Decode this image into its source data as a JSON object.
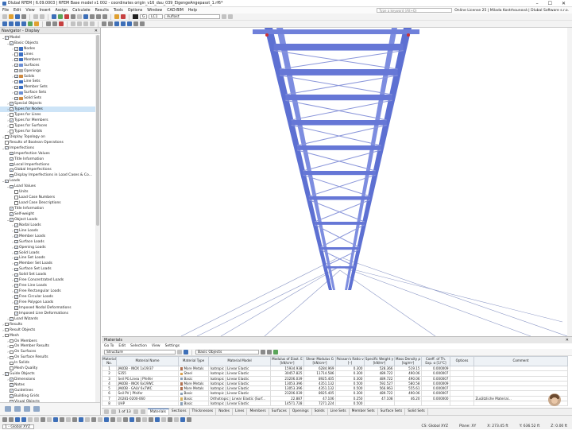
{
  "window": {
    "title": "Dlubal RFEM | 6.09.0003 | RFEM Base model v1 002 - coordinates origin_v16_dau_039_EigengeAngepasst_1.rf6*",
    "min": "–",
    "max": "☐",
    "close": "✕"
  },
  "menu": {
    "items": [
      "File",
      "Edit",
      "View",
      "Insert",
      "Assign",
      "Calculate",
      "Results",
      "Tools",
      "Options",
      "Window",
      "CAD-BIM",
      "Help"
    ],
    "search_placeholder": "Type a keyword (Alt+Q)",
    "license": "Online License 25 | Milada Kostrhounová | Dlubal Software s.r.o."
  },
  "toolbar": {
    "load_case_type": "G",
    "load_case": "LC1",
    "load_case_name": "Auflast"
  },
  "navigator": {
    "title": "Navigator - Display",
    "items": [
      {
        "level": 0,
        "exp": "⌄",
        "cb": "✓",
        "label": "Model"
      },
      {
        "level": 1,
        "exp": "⌄",
        "cb": "✓",
        "label": "Basic Objects"
      },
      {
        "level": 2,
        "exp": "›",
        "cb": "✓",
        "label": "Nodes",
        "icon": "#3b6fc4"
      },
      {
        "level": 2,
        "exp": "›",
        "cb": "",
        "label": "Lines",
        "icon": "#3b6fc4"
      },
      {
        "level": 2,
        "exp": "›",
        "cb": "✓",
        "label": "Members",
        "icon": "#3b6fc4"
      },
      {
        "level": 2,
        "exp": "›",
        "cb": "✓",
        "label": "Surfaces",
        "icon": "#6b8fd6"
      },
      {
        "level": 2,
        "exp": "",
        "cb": "✓",
        "label": "Openings",
        "icon": "#aaaaaa"
      },
      {
        "level": 2,
        "exp": "›",
        "cb": "✓",
        "label": "Solids",
        "icon": "#d08a40"
      },
      {
        "level": 2,
        "exp": "›",
        "cb": "✓",
        "label": "Line Sets",
        "icon": "#3b6fc4"
      },
      {
        "level": 2,
        "exp": "›",
        "cb": "✓",
        "label": "Member Sets",
        "icon": "#3b6fc4"
      },
      {
        "level": 2,
        "exp": "›",
        "cb": "✓",
        "label": "Surface Sets",
        "icon": "#6b8fd6"
      },
      {
        "level": 2,
        "exp": "›",
        "cb": "✓",
        "label": "Solid Sets",
        "icon": "#d08a40"
      },
      {
        "level": 1,
        "exp": "›",
        "cb": "✓",
        "label": "Special Objects"
      },
      {
        "level": 1,
        "exp": "›",
        "cb": "✓",
        "label": "Types for Nodes",
        "sel": true
      },
      {
        "level": 1,
        "exp": "›",
        "cb": "",
        "label": "Types for Lines"
      },
      {
        "level": 1,
        "exp": "›",
        "cb": "✓",
        "label": "Types for Members"
      },
      {
        "level": 1,
        "exp": "›",
        "cb": "",
        "label": "Types for Surfaces"
      },
      {
        "level": 1,
        "exp": "›",
        "cb": "",
        "label": "Types for Solids"
      },
      {
        "level": 0,
        "exp": "›",
        "cb": "",
        "label": "Display Topology on"
      },
      {
        "level": 0,
        "exp": "",
        "cb": "",
        "label": "Results of Boolean Operations"
      },
      {
        "level": 0,
        "exp": "⌄",
        "cb": "✓",
        "label": "Imperfections"
      },
      {
        "level": 1,
        "exp": "",
        "cb": "✓",
        "label": "Imperfection Values"
      },
      {
        "level": 1,
        "exp": "",
        "cb": "✓",
        "label": "Title Information"
      },
      {
        "level": 1,
        "exp": "",
        "cb": "✓",
        "label": "Local Imperfections"
      },
      {
        "level": 1,
        "exp": "",
        "cb": "✓",
        "label": "Global Imperfections"
      },
      {
        "level": 1,
        "exp": "",
        "cb": "✓",
        "label": "Display Imperfections in Load Cases & Co..."
      },
      {
        "level": 0,
        "exp": "⌄",
        "cb": "✓",
        "label": "Loads"
      },
      {
        "level": 1,
        "exp": "⌄",
        "cb": "✓",
        "label": "Load Values"
      },
      {
        "level": 2,
        "exp": "",
        "cb": "",
        "label": "Units"
      },
      {
        "level": 2,
        "exp": "",
        "cb": "",
        "label": "Load Case Numbers"
      },
      {
        "level": 2,
        "exp": "",
        "cb": "",
        "label": "Load Case Descriptions"
      },
      {
        "level": 1,
        "exp": "",
        "cb": "✓",
        "label": "Title Information"
      },
      {
        "level": 1,
        "exp": "",
        "cb": "✓",
        "label": "Self-weight"
      },
      {
        "level": 1,
        "exp": "⌄",
        "cb": "✓",
        "label": "Object Loads"
      },
      {
        "level": 2,
        "exp": "›",
        "cb": "✓",
        "label": "Nodal Loads"
      },
      {
        "level": 2,
        "exp": "›",
        "cb": "✓",
        "label": "Line Loads"
      },
      {
        "level": 2,
        "exp": "›",
        "cb": "✓",
        "label": "Member Loads"
      },
      {
        "level": 2,
        "exp": "›",
        "cb": "✓",
        "label": "Surface Loads"
      },
      {
        "level": 2,
        "exp": "›",
        "cb": "✓",
        "label": "Opening Loads"
      },
      {
        "level": 2,
        "exp": "›",
        "cb": "✓",
        "label": "Solid Loads"
      },
      {
        "level": 2,
        "exp": "›",
        "cb": "✓",
        "label": "Line Set Loads"
      },
      {
        "level": 2,
        "exp": "›",
        "cb": "✓",
        "label": "Member Set Loads"
      },
      {
        "level": 2,
        "exp": "›",
        "cb": "✓",
        "label": "Surface Set Loads"
      },
      {
        "level": 2,
        "exp": "›",
        "cb": "✓",
        "label": "Solid Set Loads"
      },
      {
        "level": 2,
        "exp": "›",
        "cb": "✓",
        "label": "Free Concentrated Loads"
      },
      {
        "level": 2,
        "exp": "›",
        "cb": "✓",
        "label": "Free Line Loads"
      },
      {
        "level": 2,
        "exp": "›",
        "cb": "✓",
        "label": "Free Rectangular Loads"
      },
      {
        "level": 2,
        "exp": "›",
        "cb": "✓",
        "label": "Free Circular Loads"
      },
      {
        "level": 2,
        "exp": "›",
        "cb": "✓",
        "label": "Free Polygon Loads"
      },
      {
        "level": 2,
        "exp": "",
        "cb": "✓",
        "label": "Imposed Nodal Deformations"
      },
      {
        "level": 2,
        "exp": "",
        "cb": "✓",
        "label": "Imposed Line Deformations"
      },
      {
        "level": 1,
        "exp": "›",
        "cb": "✓",
        "label": "Load Wizards"
      },
      {
        "level": 0,
        "exp": "›",
        "cb": "",
        "label": "Results"
      },
      {
        "level": 0,
        "exp": "›",
        "cb": "",
        "label": "Result Objects"
      },
      {
        "level": 0,
        "exp": "⌄",
        "cb": "",
        "label": "Mesh"
      },
      {
        "level": 1,
        "exp": "›",
        "cb": "",
        "label": "On Members"
      },
      {
        "level": 1,
        "exp": "›",
        "cb": "",
        "label": "On Member Results"
      },
      {
        "level": 1,
        "exp": "›",
        "cb": "",
        "label": "On Surfaces"
      },
      {
        "level": 1,
        "exp": "›",
        "cb": "",
        "label": "On Surface Results"
      },
      {
        "level": 1,
        "exp": "",
        "cb": "",
        "label": "In Solids"
      },
      {
        "level": 1,
        "exp": "",
        "cb": "",
        "label": "Mesh Quality"
      },
      {
        "level": 0,
        "exp": "⌄",
        "cb": "✓",
        "label": "Guide Objects"
      },
      {
        "level": 1,
        "exp": "›",
        "cb": "✓",
        "label": "Dimensions"
      },
      {
        "level": 1,
        "exp": "",
        "cb": "✓",
        "label": "Notes"
      },
      {
        "level": 1,
        "exp": "",
        "cb": "✓",
        "label": "Guidelines"
      },
      {
        "level": 1,
        "exp": "",
        "cb": "✓",
        "label": "Building Grids"
      },
      {
        "level": 1,
        "exp": "",
        "cb": "✓",
        "label": "Visual Objects"
      }
    ]
  },
  "materials": {
    "title": "Materials",
    "menu": [
      "Go To",
      "Edit",
      "Selection",
      "View",
      "Settings"
    ],
    "filter": "Structure",
    "filter2": "Basic Objects",
    "columns": [
      "Material No.",
      "Material Name",
      "Material Type",
      "Material Model",
      "Modulus of Elast. E [kN/cm²]",
      "Shear Modulus G [kN/cm²]",
      "Poisson's Ratio ν [–]",
      "Specific Weight γ [kN/m³]",
      "Mass Density ρ [kg/m³]",
      "Coeff. of Th. Exp. α [1/°C]",
      "Options",
      "Comment"
    ],
    "rows": [
      [
        "1",
        "JAKOB - INOX 1x19/37",
        "More Metals",
        "Isotropic | Linear Elastic",
        "15934.938",
        "6284.969",
        "0.300",
        "528.366",
        "519.15",
        "0.000009",
        "",
        ""
      ],
      [
        "2",
        "S355",
        "Steel",
        "Isotropic | Linear Elastic",
        "30457.825",
        "11714.586",
        "0.300",
        "489.722",
        "490.06",
        "0.000007",
        "",
        ""
      ],
      [
        "3",
        "Seil PG Linea | Pfeifer",
        "Basic",
        "Isotropic | Linear Elastic",
        "23206.039",
        "8925.405",
        "0.300",
        "489.722",
        "490.06",
        "0.000007",
        "",
        ""
      ],
      [
        "4",
        "JAKOB - INOX 6x19WC",
        "More Metals",
        "Isotropic | Linear Elastic",
        "13053.396",
        "4351.132",
        "0.500",
        "592.527",
        "580.58",
        "0.000009",
        "",
        ""
      ],
      [
        "5",
        "JAKOB - GALV 6x7WC",
        "More Metals",
        "Isotropic | Linear Elastic",
        "13053.396",
        "4351.132",
        "0.500",
        "566.963",
        "555.61",
        "0.000007",
        "",
        ""
      ],
      [
        "6",
        "Seil PV | Pfeifer",
        "Basic",
        "Isotropic | Linear Elastic",
        "23206.039",
        "8925.405",
        "0.300",
        "489.722",
        "490.06",
        "0.000007",
        "",
        ""
      ],
      [
        "7",
        "20281-0200-060",
        "Basic",
        "Orthotropic | Linear Elastic (Surf...",
        "22.887",
        "47.106",
        "0.250",
        "47.108",
        "46.20",
        "0.000000",
        "",
        "Zusätzliche Material..."
      ],
      [
        "8",
        "UHP",
        "Basic",
        "Isotropic | Linear Elastic",
        "14571.728",
        "7271.224",
        "0.500",
        "",
        "",
        "",
        "",
        ""
      ]
    ],
    "swatches": [
      "#b07050",
      "#d8a050",
      "#8aa0b8",
      "#b07050",
      "#b07050",
      "#8aa0b8",
      "#d4b060",
      "#8aa0b8"
    ],
    "page": "1 of 13",
    "tabs": [
      "Materials",
      "Sections",
      "Thicknesses",
      "Nodes",
      "Lines",
      "Members",
      "Surfaces",
      "Openings",
      "Solids",
      "Line Sets",
      "Member Sets",
      "Surface Sets",
      "Solid Sets"
    ]
  },
  "status": {
    "view": "1 - Global XYZ",
    "cs": "CS: Global XYZ",
    "plane": "Plane: XY",
    "x": "X: 273.45 ft",
    "y": "Y: 636.52 ft",
    "z": "Z: 0.00 ft"
  }
}
